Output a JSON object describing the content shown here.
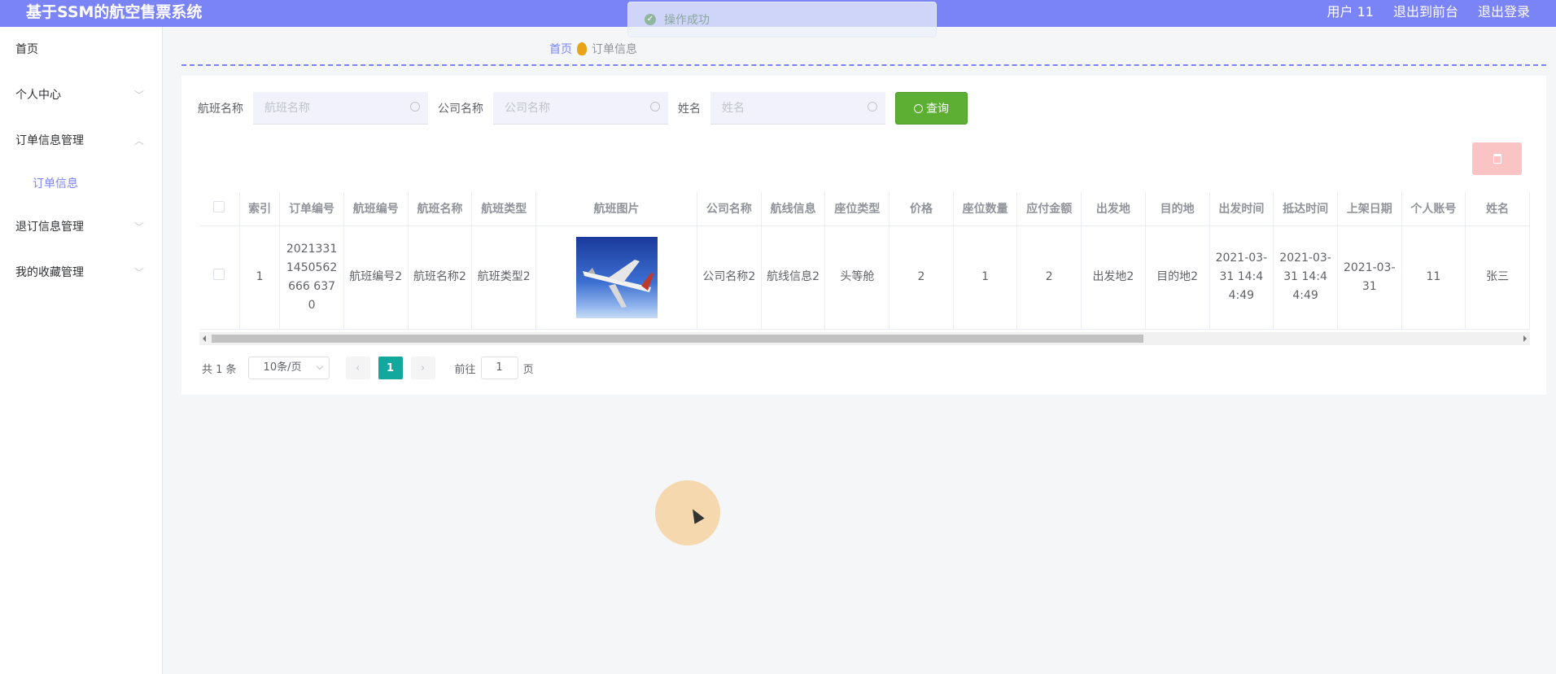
{
  "app": {
    "title": "基于SSM的航空售票系统"
  },
  "topbar": {
    "user": "用户 11",
    "front_link": "退出到前台",
    "logout": "退出登录"
  },
  "toast": {
    "message": "操作成功"
  },
  "sidebar": {
    "items": [
      {
        "label": "首页",
        "has_arrow": false
      },
      {
        "label": "个人中心",
        "has_arrow": true
      },
      {
        "label": "订单信息管理",
        "has_arrow": true,
        "expanded": true
      },
      {
        "label": "订单信息",
        "sub": true
      },
      {
        "label": "退订信息管理",
        "has_arrow": true
      },
      {
        "label": "我的收藏管理",
        "has_arrow": true
      }
    ]
  },
  "breadcrumb": {
    "home": "首页",
    "current": "订单信息"
  },
  "search": {
    "flight_name_label": "航班名称",
    "flight_name_placeholder": "航班名称",
    "company_label": "公司名称",
    "company_placeholder": "公司名称",
    "name_label": "姓名",
    "name_placeholder": "姓名",
    "button": "查询"
  },
  "table": {
    "headers": [
      "索引",
      "订单编号",
      "航班编号",
      "航班名称",
      "航班类型",
      "航班图片",
      "公司名称",
      "航线信息",
      "座位类型",
      "价格",
      "座位数量",
      "应付金额",
      "出发地",
      "目的地",
      "出发时间",
      "抵达时间",
      "上架日期",
      "个人账号",
      "姓名"
    ],
    "rows": [
      [
        "1",
        "20213311450562666 6370",
        "航班编号2",
        "航班名称2",
        "航班类型2",
        "",
        "公司名称2",
        "航线信息2",
        "头等舱",
        "2",
        "1",
        "2",
        "出发地2",
        "目的地2",
        "2021-03-31 14:44:49",
        "2021-03-31 14:44:49",
        "2021-03-31",
        "11",
        "张三"
      ]
    ]
  },
  "pager": {
    "total": "共 1 条",
    "page_size": "10条/页",
    "current_page": "1",
    "goto_label": "前往",
    "goto_value": "1",
    "page_unit": "页"
  },
  "colors": {
    "brand": "#7b84f7",
    "search_btn": "#5daf34",
    "active_page": "#13a89e",
    "delete_btn": "#fbc4c4"
  }
}
